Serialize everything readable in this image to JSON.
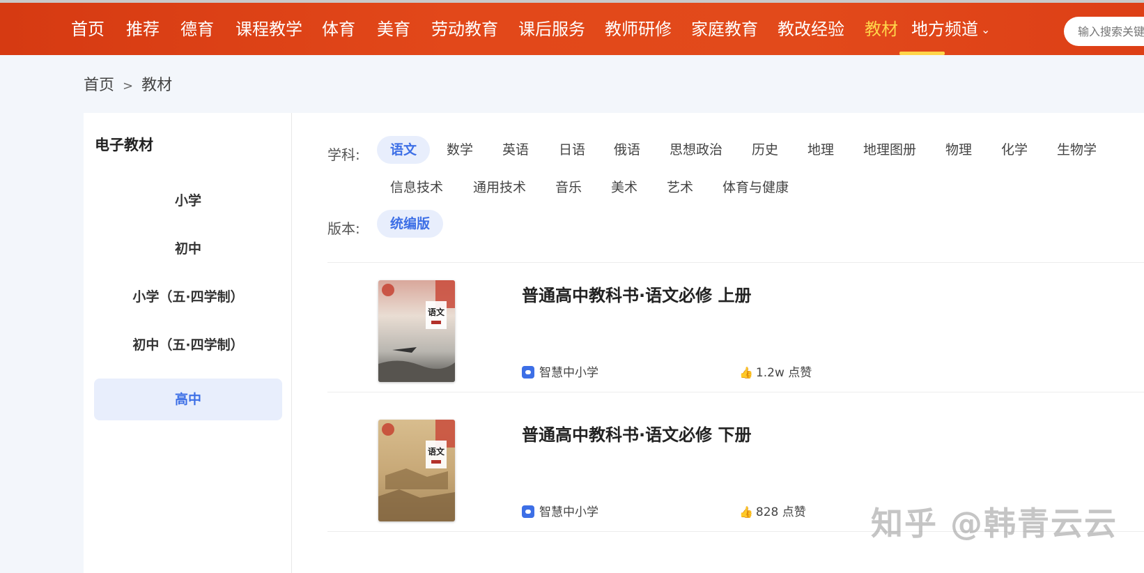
{
  "nav": {
    "items": [
      "首页",
      "推荐",
      "德育",
      "课程教学",
      "体育",
      "美育",
      "劳动教育",
      "课后服务",
      "教师研修",
      "家庭教育",
      "教改经验",
      "教材",
      "地方频道"
    ],
    "active": "教材",
    "search_placeholder": "输入搜索关键"
  },
  "breadcrumb": {
    "home": "首页",
    "sep": ">",
    "current": "教材"
  },
  "sidebar": {
    "title": "电子教材",
    "items": [
      {
        "label": "小学"
      },
      {
        "label": "初中"
      },
      {
        "label": "小学（五·四学制）"
      },
      {
        "label": "初中（五·四学制）"
      },
      {
        "label": "高中"
      }
    ],
    "active": "高中"
  },
  "filters": {
    "subject_label": "学科:",
    "subjects_row1": [
      "语文",
      "数学",
      "英语",
      "日语",
      "俄语",
      "思想政治",
      "历史",
      "地理",
      "地理图册",
      "物理",
      "化学",
      "生物学"
    ],
    "subjects_row2": [
      "信息技术",
      "通用技术",
      "音乐",
      "美术",
      "艺术",
      "体育与健康"
    ],
    "active_subject": "语文",
    "edition_label": "版本:",
    "editions": [
      "统编版"
    ]
  },
  "books": [
    {
      "title": "普通高中教科书·语文必修 上册",
      "source": "智慧中小学",
      "likes": "1.2w 点赞",
      "cover_color": "#c9b8a3"
    },
    {
      "title": "普通高中教科书·语文必修 下册",
      "source": "智慧中小学",
      "likes": "828 点赞",
      "cover_color": "#c7a97c"
    }
  ],
  "watermark": "知乎 @韩青云云",
  "colors": {
    "nav_bg": "#e2481a",
    "accent": "#3d6fe6",
    "nav_active": "#ffd54a"
  }
}
